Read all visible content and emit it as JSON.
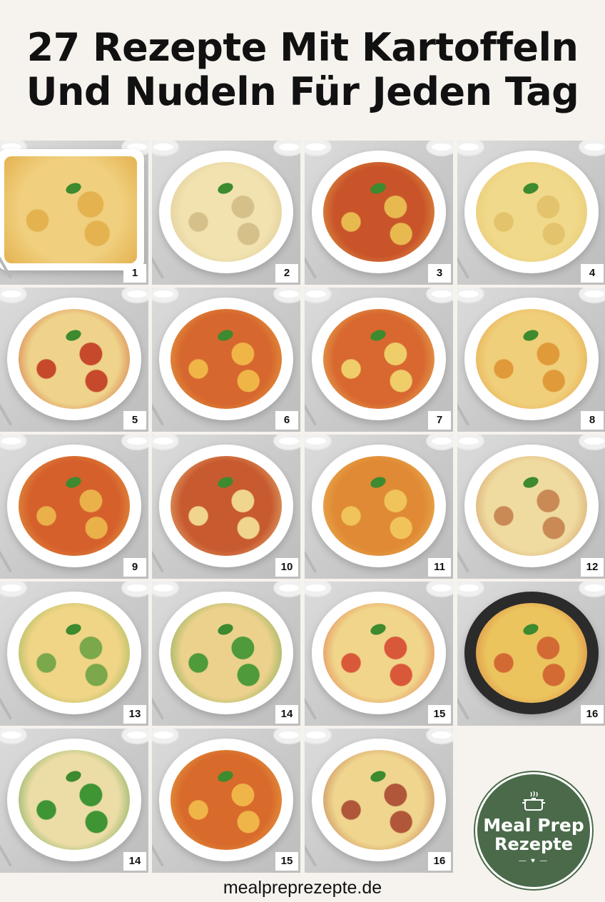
{
  "title": "27 Rezepte Mit Kartoffeln Und Nudeln Für Jeden Tag",
  "footer": "mealpreprezepte.de",
  "logo": {
    "line1": "Meal Prep",
    "line2": "Rezepte",
    "color": "#4a6a4a"
  },
  "tiles": [
    {
      "number": "1",
      "dish": "cheesy pasta bake in white casserole dish",
      "colors": [
        "#f0cf7e",
        "#e4b24f"
      ]
    },
    {
      "number": "2",
      "dish": "gnocchi in creamy herb sauce with basil",
      "colors": [
        "#f1e2b0",
        "#d6c08a"
      ]
    },
    {
      "number": "3",
      "dish": "gnocchi with meat ragù and basil",
      "colors": [
        "#c9542a",
        "#e8b94f"
      ]
    },
    {
      "number": "4",
      "dish": "potato and pasta in cream sauce",
      "colors": [
        "#f0d98a",
        "#e3c36b"
      ]
    },
    {
      "number": "5",
      "dish": "gnocchi with tomato sauce and parmesan",
      "colors": [
        "#efd38a",
        "#c6492b"
      ]
    },
    {
      "number": "6",
      "dish": "potato and spaghetti tomato stew",
      "colors": [
        "#d6672e",
        "#f0b547"
      ]
    },
    {
      "number": "7",
      "dish": "spaghetti potato vegetable stew",
      "colors": [
        "#d8682f",
        "#efce6a"
      ]
    },
    {
      "number": "8",
      "dish": "potato tagliatelle with herbs",
      "colors": [
        "#f0cf7a",
        "#e09a3a"
      ]
    },
    {
      "number": "9",
      "dish": "spaghetti potato soup",
      "colors": [
        "#d5602c",
        "#eab14a"
      ]
    },
    {
      "number": "10",
      "dish": "gnocchi with meat sauce and basil",
      "colors": [
        "#c85a30",
        "#f0d58c"
      ]
    },
    {
      "number": "11",
      "dish": "potato spaghetti in tomato broth",
      "colors": [
        "#e08a36",
        "#f0c45a"
      ]
    },
    {
      "number": "12",
      "dish": "pasta with bacon and herbs",
      "colors": [
        "#efdba0",
        "#c98a55"
      ]
    },
    {
      "number": "13",
      "dish": "gnocchi with tomato and herbs",
      "colors": [
        "#f0d586",
        "#7aa84a"
      ]
    },
    {
      "number": "14",
      "dish": "potato pasta salad with greens",
      "colors": [
        "#ecd18c",
        "#4f9a3a"
      ]
    },
    {
      "number": "15",
      "dish": "pasta potato with tomatoes",
      "colors": [
        "#f0d58a",
        "#d9583a"
      ]
    },
    {
      "number": "16",
      "dish": "spaghetti potato skillet",
      "colors": [
        "#ebc45e",
        "#d36a34"
      ]
    },
    {
      "number": "14",
      "dish": "pasta with broccoli and tomatoes",
      "colors": [
        "#ecdca6",
        "#3f9434"
      ]
    },
    {
      "number": "15",
      "dish": "potato bean stew with basil",
      "colors": [
        "#d86a2c",
        "#f0b548"
      ]
    },
    {
      "number": "16",
      "dish": "gnocchi with bacon and herbs",
      "colors": [
        "#efd58e",
        "#b0573a"
      ]
    }
  ]
}
